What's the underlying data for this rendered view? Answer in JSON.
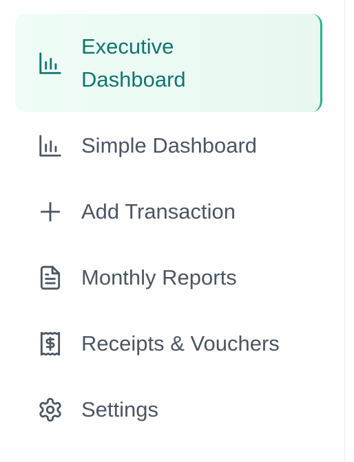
{
  "sidebar": {
    "accent_color": "#0f766e",
    "active_border_color": "#21b38d",
    "text_color": "#4b5563",
    "items": [
      {
        "label": "Executive Dashboard",
        "icon": "bar-chart-icon",
        "active": true
      },
      {
        "label": "Simple Dashboard",
        "icon": "bar-chart-icon",
        "active": false
      },
      {
        "label": "Add Transaction",
        "icon": "plus-icon",
        "active": false
      },
      {
        "label": "Monthly Reports",
        "icon": "document-icon",
        "active": false
      },
      {
        "label": "Receipts & Vouchers",
        "icon": "receipt-icon",
        "active": false
      },
      {
        "label": "Settings",
        "icon": "gear-icon",
        "active": false
      }
    ]
  }
}
